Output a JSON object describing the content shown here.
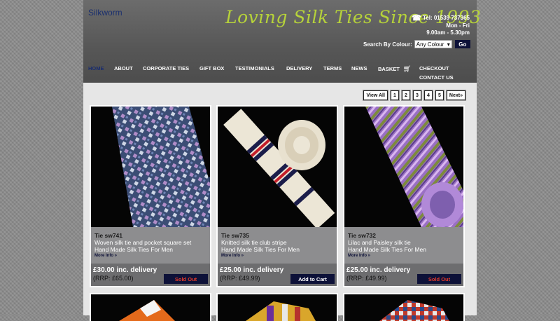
{
  "header": {
    "brand": "Silkworm",
    "tagline": "Loving Silk Ties Since 1993",
    "phone": "Tel: 01539 737365",
    "hours_days": "Mon - Fri",
    "hours_time": "9.00am - 5.30pm",
    "search_label": "Search By Colour:",
    "search_select_value": "Any Colour",
    "go_label": "Go"
  },
  "nav": {
    "items": [
      "HOME",
      "ABOUT",
      "CORPORATE TIES",
      "GIFT BOX",
      "TESTIMONIALS",
      "DELIVERY",
      "TERMS",
      "NEWS",
      "BASKET",
      "CHECKOUT",
      "CONTACT US"
    ],
    "active": "HOME"
  },
  "pager": [
    "View All",
    "1",
    "2",
    "3",
    "4",
    "5",
    "Next»"
  ],
  "products": [
    {
      "code": "Tie sw741",
      "title": "Woven silk tie and pocket square set",
      "subtitle": "Hand Made Silk Ties For Men",
      "more": "More Info »",
      "price": "£30.00 inc. delivery",
      "rrp": "(RRP: £65.00)",
      "action": "Sold Out"
    },
    {
      "code": "Tie sw735",
      "title": "Knitted silk tie club stripe",
      "subtitle": "Hand Made Silk Ties For Men",
      "more": "More Info »",
      "price": "£25.00 inc. delivery",
      "rrp": "(RRP: £49.99)",
      "action": "Add to Cart"
    },
    {
      "code": "Tie sw732",
      "title": "Lilac and Paisley silk tie",
      "subtitle": "Hand Made Silk Ties For Men",
      "more": "More Info »",
      "price": "£25.00 inc. delivery",
      "rrp": "(RRP: £49.99)",
      "action": "Sold Out"
    }
  ],
  "colors": {
    "accent_navy": "#0d1138",
    "tagline_green": "#b6d23a",
    "sold_out_red": "#e03a2a"
  },
  "icons": {
    "phone": "phone-icon",
    "basket": "basket-icon",
    "select_arrow": "chevron-down-icon"
  }
}
